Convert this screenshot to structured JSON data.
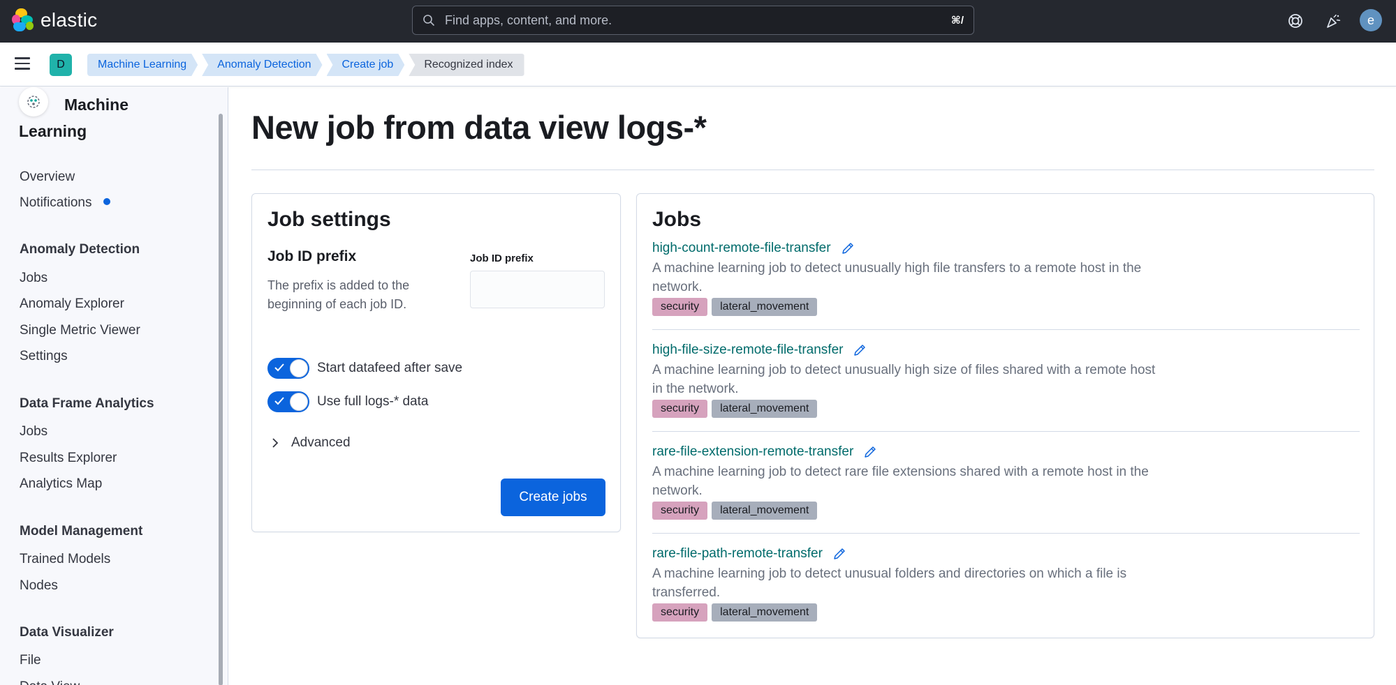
{
  "header": {
    "brand": "elastic",
    "search_placeholder": "Find apps, content, and more.",
    "search_shortcut": "⌘/",
    "avatar_initial": "e"
  },
  "breadcrumbs": {
    "space_badge": "D",
    "items": [
      {
        "label": "Machine Learning"
      },
      {
        "label": "Anomaly Detection"
      },
      {
        "label": "Create job"
      },
      {
        "label": "Recognized index"
      }
    ]
  },
  "sidebar": {
    "title": "Machine Learning",
    "overview": "Overview",
    "notifications": "Notifications",
    "groups": {
      "anomaly": {
        "title": "Anomaly Detection",
        "items": [
          "Jobs",
          "Anomaly Explorer",
          "Single Metric Viewer",
          "Settings"
        ]
      },
      "dfa": {
        "title": "Data Frame Analytics",
        "items": [
          "Jobs",
          "Results Explorer",
          "Analytics Map"
        ]
      },
      "model": {
        "title": "Model Management",
        "items": [
          "Trained Models",
          "Nodes"
        ]
      },
      "visualizer": {
        "title": "Data Visualizer",
        "items": [
          "File",
          "Data View"
        ]
      }
    }
  },
  "page": {
    "title": "New job from data view logs-*"
  },
  "job_settings": {
    "heading": "Job settings",
    "prefix_title": "Job ID prefix",
    "prefix_desc": "The prefix is added to the beginning of each job ID.",
    "prefix_input_label": "Job ID prefix",
    "prefix_value": "",
    "toggle_start_datafeed": "Start datafeed after save",
    "toggle_full_data": "Use full logs-* data",
    "advanced": "Advanced",
    "create_button": "Create jobs"
  },
  "jobs": {
    "heading": "Jobs",
    "list": [
      {
        "id": "high-count-remote-file-transfer",
        "desc": "A machine learning job to detect unusually high file transfers to a remote host in the network.",
        "tags": [
          "security",
          "lateral_movement"
        ]
      },
      {
        "id": "high-file-size-remote-file-transfer",
        "desc": "A machine learning job to detect unusually high size of files shared with a remote host in the network.",
        "tags": [
          "security",
          "lateral_movement"
        ]
      },
      {
        "id": "rare-file-extension-remote-transfer",
        "desc": "A machine learning job to detect rare file extensions shared with a remote host in the network.",
        "tags": [
          "security",
          "lateral_movement"
        ]
      },
      {
        "id": "rare-file-path-remote-transfer",
        "desc": "A machine learning job to detect unusual folders and directories on which a file is transferred.",
        "tags": [
          "security",
          "lateral_movement"
        ]
      }
    ]
  },
  "colors": {
    "header_bg": "#25282f",
    "primary": "#0b64dd",
    "link_teal": "#006b6b",
    "tag_security": "#d6a2bd",
    "tag_lateral": "#a7aebb"
  }
}
